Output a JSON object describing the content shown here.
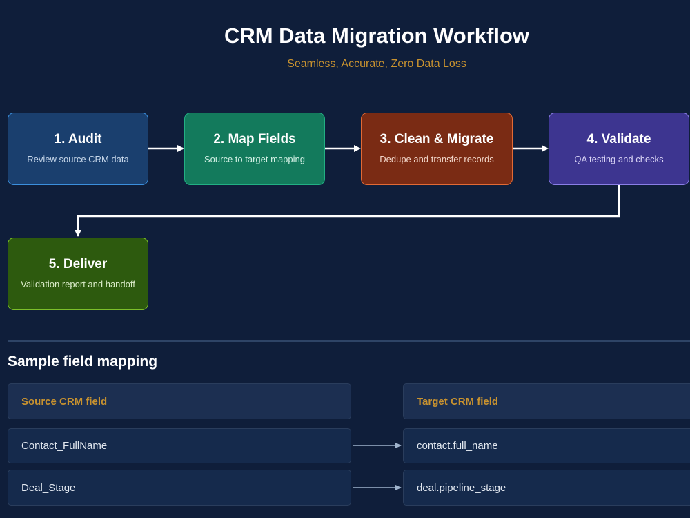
{
  "header": {
    "title": "CRM Data Migration Workflow",
    "subtitle": "Seamless, Accurate, Zero Data Loss"
  },
  "steps": [
    {
      "title": "1. Audit",
      "description": "Review source CRM data",
      "fill": "#1a3f6e",
      "border": "#3b8fdd"
    },
    {
      "title": "2. Map Fields",
      "description": "Source to target mapping",
      "fill": "#137a5c",
      "border": "#22b083"
    },
    {
      "title": "3. Clean & Migrate",
      "description": "Dedupe and transfer records",
      "fill": "#7a2b14",
      "border": "#e26a35"
    },
    {
      "title": "4. Validate",
      "description": "QA testing and checks",
      "fill": "#3d3590",
      "border": "#8a7ee6"
    },
    {
      "title": "5. Deliver",
      "description": "Validation report and handoff",
      "fill": "#2d5a0e",
      "border": "#7cbf2a"
    }
  ],
  "mapping": {
    "section_title": "Sample field mapping",
    "source_header": "Source CRM field",
    "target_header": "Target CRM field",
    "rows": [
      {
        "source": "Contact_FullName",
        "target": "contact.full_name"
      },
      {
        "source": "Deal_Stage",
        "target": "deal.pipeline_stage"
      }
    ]
  },
  "colors": {
    "background": "#0f1e3a",
    "accent": "#c8922f",
    "connector": "#ffffff",
    "mapping_arrow": "#9fb3cc"
  }
}
